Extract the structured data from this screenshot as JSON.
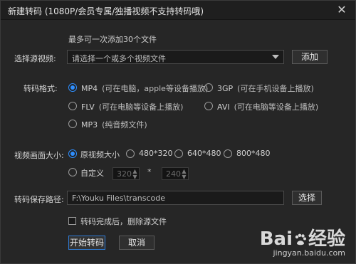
{
  "window": {
    "title": "新建转码 (1080P/会员专属/独播视频不支持转码哦)"
  },
  "source": {
    "hint": "最多可一次添加30个文件",
    "label": "选择源视频:",
    "select_value": "请选择一个或多个视频文件",
    "add_label": "添加"
  },
  "format": {
    "label": "转码格式:",
    "options": [
      {
        "name": "MP4",
        "desc": "(可在电脑，apple等设备播放)",
        "selected": true
      },
      {
        "name": "3GP",
        "desc": "(可在手机设备上播放)",
        "selected": false
      },
      {
        "name": "FLV",
        "desc": "(可在电脑等设备上播放)",
        "selected": false
      },
      {
        "name": "AVI",
        "desc": "(可在电脑等设备上播放)",
        "selected": false
      },
      {
        "name": "MP3",
        "desc": "(纯音频文件)",
        "selected": false
      }
    ]
  },
  "size": {
    "label": "视频画面大小:",
    "options": [
      {
        "label": "原视频大小",
        "selected": true
      },
      {
        "label": "480*320",
        "selected": false
      },
      {
        "label": "640*480",
        "selected": false
      },
      {
        "label": "800*480",
        "selected": false
      }
    ],
    "custom_label": "自定义",
    "custom_width": "320",
    "times": "*",
    "custom_height": "240"
  },
  "save": {
    "label": "转码保存路径:",
    "path": "F:\\Youku Files\\transcode",
    "choose_label": "选择"
  },
  "delete_after": {
    "label": "转码完成后，删除源文件",
    "checked": false
  },
  "actions": {
    "start_label": "开始转码",
    "cancel_label": "取消"
  },
  "watermark": {
    "logo_a": "Bai",
    "logo_b": "经验",
    "url": "jingyan.baidu.com"
  },
  "colors": {
    "accent": "#2f8fff",
    "background": "#262626"
  }
}
